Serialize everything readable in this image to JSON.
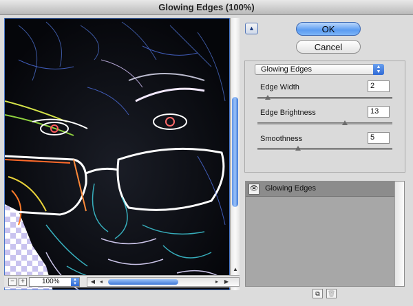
{
  "window": {
    "title": "Glowing Edges (100%)"
  },
  "preview": {
    "zoom_out_icon": "minus-icon",
    "zoom_in_icon": "plus-icon",
    "zoom_value": "100%"
  },
  "buttons": {
    "ok": "OK",
    "cancel": "Cancel",
    "collapse_icon": "triangle-up-icon"
  },
  "options": {
    "filter_selected": "Glowing Edges",
    "params": [
      {
        "label": "Edge Width",
        "value": "2",
        "slider_fraction": 0.077
      },
      {
        "label": "Edge Brightness",
        "value": "13",
        "slider_fraction": 0.65
      },
      {
        "label": "Smoothness",
        "value": "5",
        "slider_fraction": 0.3
      }
    ]
  },
  "layers": {
    "items": [
      {
        "name": "Glowing Edges",
        "visibility_icon": "eye-icon"
      }
    ],
    "new_layer_icon": "new-layer-icon",
    "delete_icon": "trash-icon"
  },
  "colors": {
    "accent": "#5b9cf1",
    "preview_bg": "#05060a"
  }
}
